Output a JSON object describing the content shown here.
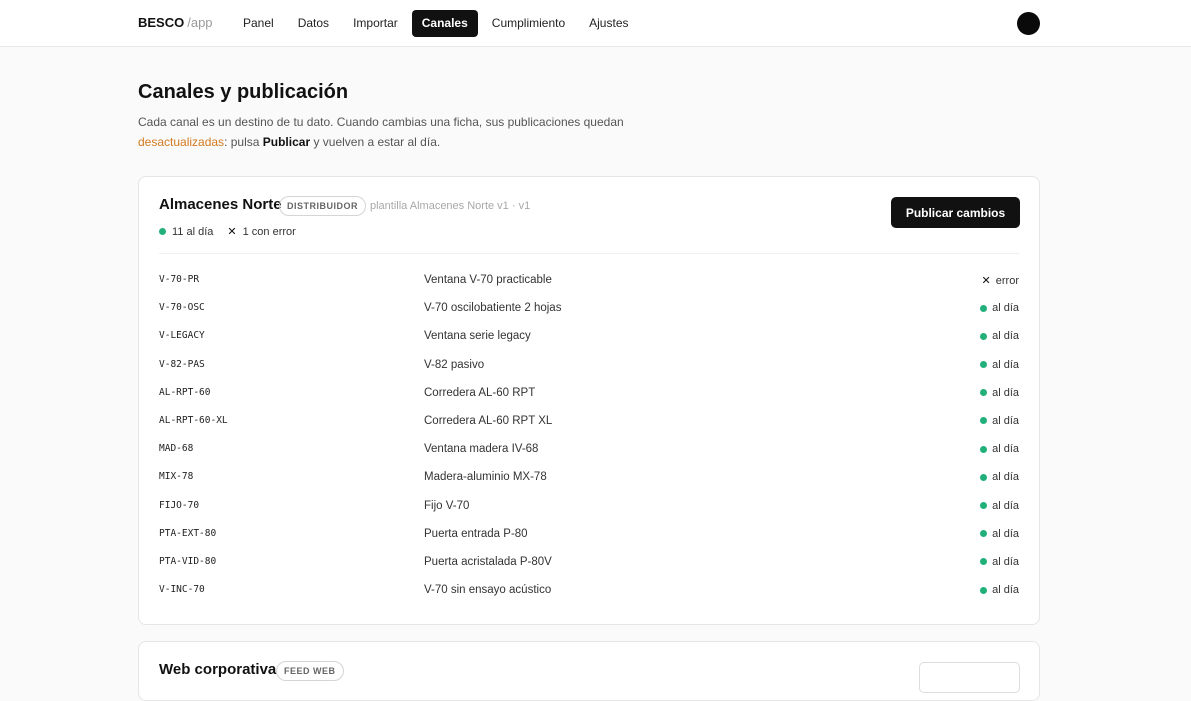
{
  "brand": {
    "name": "BESCO",
    "sub": "/app"
  },
  "nav": [
    {
      "label": "Panel",
      "active": false
    },
    {
      "label": "Datos",
      "active": false
    },
    {
      "label": "Importar",
      "active": false
    },
    {
      "label": "Canales",
      "active": true
    },
    {
      "label": "Cumplimiento",
      "active": false
    },
    {
      "label": "Ajustes",
      "active": false
    }
  ],
  "page": {
    "title": "Canales y publicación",
    "intro_a": "Cada canal es un destino de tu dato. Cuando cambias una ficha, sus publicaciones quedan",
    "intro_highlight": "desactualizadas",
    "intro_b": ": pulsa ",
    "intro_bold": "Publicar",
    "intro_c": " y vuelven a estar al día."
  },
  "channel": {
    "name": "Almacenes Norte",
    "badge": "DISTRIBUIDOR",
    "template": "plantilla Almacenes Norte v1 · v1",
    "stat_ok": "11 al día",
    "stat_err": "1 con error",
    "button": "Publicar cambios",
    "colors": {
      "ok": "#22b07a",
      "highlight": "#d27a1e"
    },
    "rows": [
      {
        "sku": "V-70-PR",
        "name": "Ventana V-70 practicable",
        "status": "error",
        "ok": false
      },
      {
        "sku": "V-70-OSC",
        "name": "V-70 oscilobatiente 2 hojas",
        "status": "al día",
        "ok": true
      },
      {
        "sku": "V-LEGACY",
        "name": "Ventana serie legacy",
        "status": "al día",
        "ok": true
      },
      {
        "sku": "V-82-PAS",
        "name": "V-82 pasivo",
        "status": "al día",
        "ok": true
      },
      {
        "sku": "AL-RPT-60",
        "name": "Corredera AL-60 RPT",
        "status": "al día",
        "ok": true
      },
      {
        "sku": "AL-RPT-60-XL",
        "name": "Corredera AL-60 RPT XL",
        "status": "al día",
        "ok": true
      },
      {
        "sku": "MAD-68",
        "name": "Ventana madera IV-68",
        "status": "al día",
        "ok": true
      },
      {
        "sku": "MIX-78",
        "name": "Madera-aluminio MX-78",
        "status": "al día",
        "ok": true
      },
      {
        "sku": "FIJO-70",
        "name": "Fijo V-70",
        "status": "al día",
        "ok": true
      },
      {
        "sku": "PTA-EXT-80",
        "name": "Puerta entrada P-80",
        "status": "al día",
        "ok": true
      },
      {
        "sku": "PTA-VID-80",
        "name": "Puerta acristalada P-80V",
        "status": "al día",
        "ok": true
      },
      {
        "sku": "V-INC-70",
        "name": "V-70 sin ensayo acústico",
        "status": "al día",
        "ok": true
      }
    ]
  },
  "channel2": {
    "name": "Web corporativa",
    "badge": "FEED WEB"
  }
}
